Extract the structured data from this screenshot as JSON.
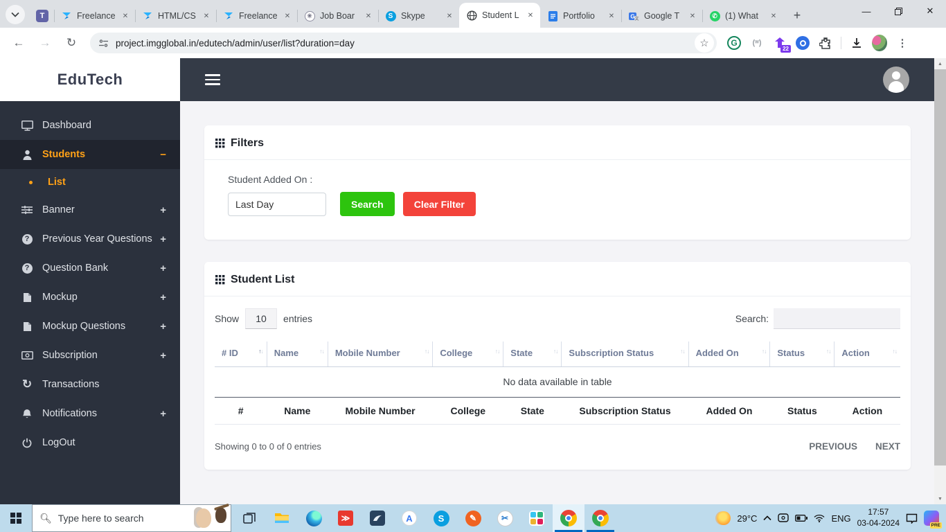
{
  "browser": {
    "tabs": [
      {
        "label": "Freelance",
        "icon": "freelancer-icon"
      },
      {
        "label": "HTML/CS",
        "icon": "freelancer-icon"
      },
      {
        "label": "Freelance",
        "icon": "freelancer-icon"
      },
      {
        "label": "Job Boar",
        "icon": "chatgpt-icon"
      },
      {
        "label": "Skype",
        "icon": "skype-icon"
      },
      {
        "label": "Student L",
        "icon": "globe-icon",
        "active": true
      },
      {
        "label": "Portfolio",
        "icon": "docs-icon"
      },
      {
        "label": "Google T",
        "icon": "translate-icon"
      },
      {
        "label": "(1) What",
        "icon": "whatsapp-icon"
      }
    ],
    "url": "project.imgglobal.in/edutech/admin/user/list?duration=day",
    "extension_badge": "22"
  },
  "sidebar": {
    "brand": "EduTech",
    "items": [
      {
        "label": "Dashboard",
        "icon": "monitor-icon"
      },
      {
        "label": "Students",
        "icon": "person-icon",
        "active": true,
        "toggle": "−"
      },
      {
        "label": "List",
        "sub": true
      },
      {
        "label": "Banner",
        "icon": "sliders-icon",
        "toggle": "+"
      },
      {
        "label": "Previous Year Questions",
        "icon": "question-icon",
        "toggle": "+"
      },
      {
        "label": "Question Bank",
        "icon": "question-icon",
        "toggle": "+"
      },
      {
        "label": "Mockup",
        "icon": "file-icon",
        "toggle": "+"
      },
      {
        "label": "Mockup Questions",
        "icon": "file-icon",
        "toggle": "+"
      },
      {
        "label": "Subscription",
        "icon": "cash-icon",
        "toggle": "+"
      },
      {
        "label": "Transactions",
        "icon": "history-icon"
      },
      {
        "label": "Notifications",
        "icon": "bell-icon",
        "toggle": "+"
      },
      {
        "label": "LogOut",
        "icon": "power-icon"
      }
    ]
  },
  "main": {
    "filters": {
      "title": "Filters",
      "field_label": "Student Added On :",
      "field_value": "Last Day",
      "search_button": "Search",
      "clear_button": "Clear Filter"
    },
    "student_list": {
      "title": "Student List",
      "show_label": "Show",
      "page_size": "10",
      "entries_label": "entries",
      "search_label": "Search:",
      "search_value": "",
      "columns": [
        "# ID",
        "Name",
        "Mobile Number",
        "College",
        "State",
        "Subscription Status",
        "Added On",
        "Status",
        "Action"
      ],
      "footer_columns": [
        "#",
        "Name",
        "Mobile Number",
        "College",
        "State",
        "Subscription Status",
        "Added On",
        "Status",
        "Action"
      ],
      "empty_text": "No data available in table",
      "summary": "Showing 0 to 0 of 0 entries",
      "previous_label": "PREVIOUS",
      "next_label": "NEXT"
    }
  },
  "taskbar": {
    "search_placeholder": "Type here to search",
    "apps": [
      {
        "name": "task-view-icon"
      },
      {
        "name": "file-explorer-icon"
      },
      {
        "name": "edge-icon"
      },
      {
        "name": "dev-app-icon"
      },
      {
        "name": "database-app-icon"
      },
      {
        "name": "design-app-icon"
      },
      {
        "name": "skype-app-icon"
      },
      {
        "name": "orange-app-icon"
      },
      {
        "name": "snip-app-icon"
      },
      {
        "name": "slack-icon"
      },
      {
        "name": "chrome-icon",
        "active": true,
        "indicator": true
      },
      {
        "name": "chrome-icon",
        "indicator": true
      }
    ],
    "tray": {
      "temperature": "29°C",
      "language": "ENG",
      "time": "17:57",
      "date": "03-04-2024",
      "copilot_badge": "PRE"
    }
  }
}
